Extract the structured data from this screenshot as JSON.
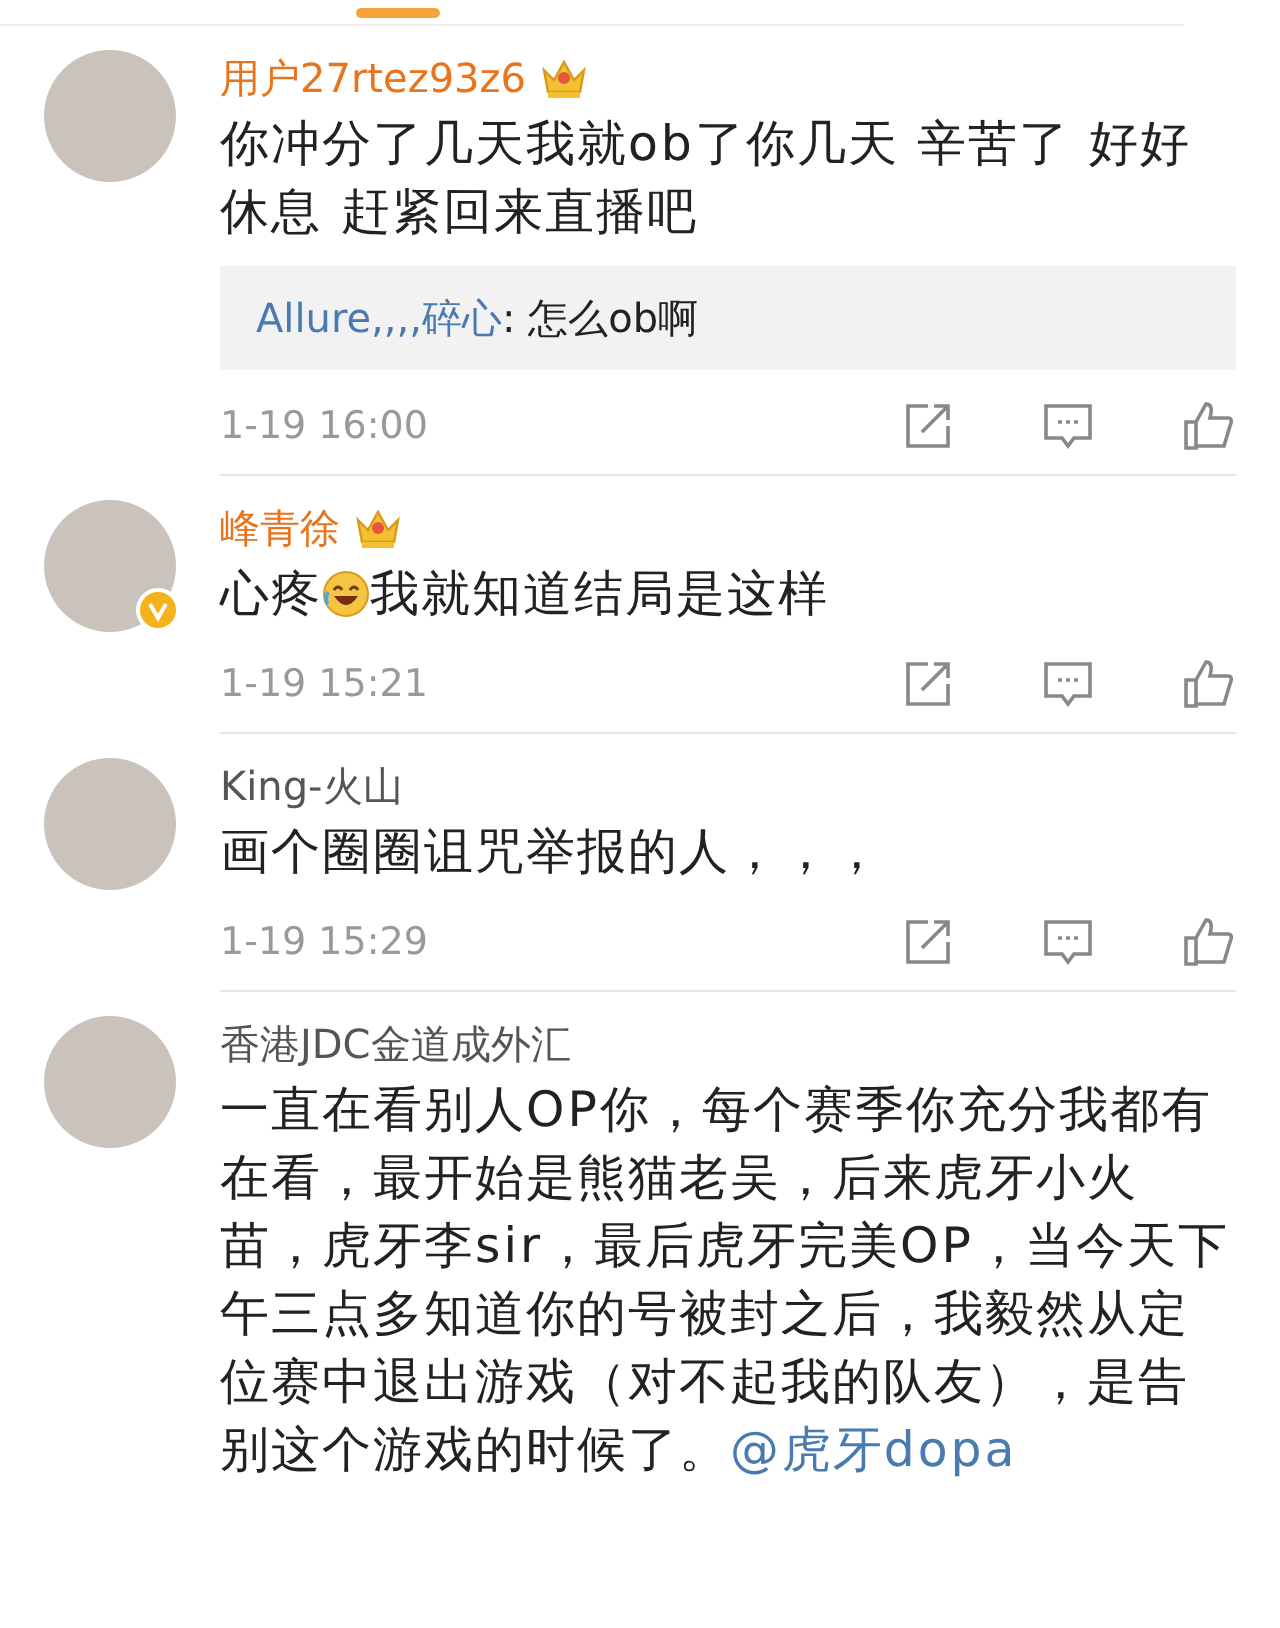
{
  "comments": [
    {
      "name": "用户27rtez93z6",
      "vip": true,
      "verified": false,
      "body": [
        {
          "kind": "text",
          "text": "你冲分了几天我就ob了你几天 辛苦了 好好休息 赶紧回来直播吧"
        }
      ],
      "replies": [
        {
          "author": "Allure,,,,碎心",
          "text": ": 怎么ob啊"
        }
      ],
      "time": "1-19 16:00"
    },
    {
      "name": "峰青徐",
      "vip": true,
      "verified": true,
      "body": [
        {
          "kind": "text",
          "text": "心疼"
        },
        {
          "kind": "emoji"
        },
        {
          "kind": "text",
          "text": "我就知道结局是这样"
        }
      ],
      "time": "1-19 15:21"
    },
    {
      "name": "King-火山",
      "vip": false,
      "verified": false,
      "body": [
        {
          "kind": "text",
          "text": "画个圈圈诅咒举报的人，，，"
        }
      ],
      "time": "1-19 15:29"
    },
    {
      "name": "香港JDC金道成外汇",
      "vip": false,
      "verified": false,
      "body": [
        {
          "kind": "text",
          "text": "一直在看别人OP你，每个赛季你充分我都有在看，最开始是熊猫老吴，后来虎牙小火苗，虎牙李sir，最后虎牙完美OP，当今天下午三点多知道你的号被封之后，我毅然从定位赛中退出游戏（对不起我的队友），是告别这个游戏的时候了。"
        },
        {
          "kind": "mention",
          "text": "@虎牙dopa"
        }
      ]
    }
  ]
}
